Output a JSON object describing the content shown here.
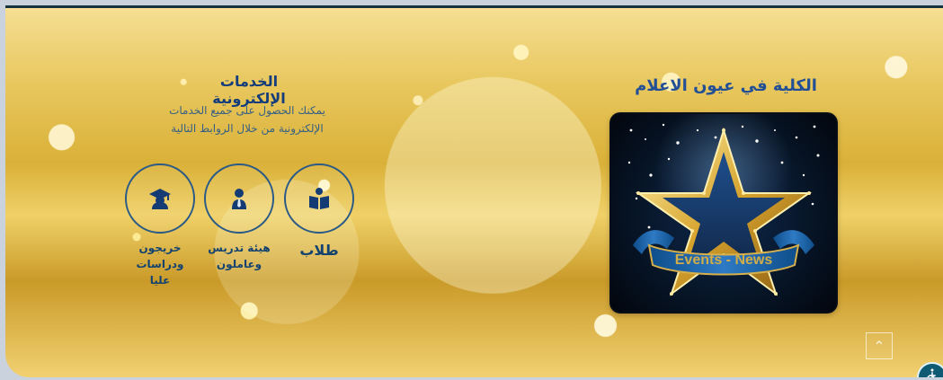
{
  "services": {
    "title": "الخدمات الإلكترونية",
    "description_line_1": "يمكنك الحصول على جميع الخدمات",
    "description_line_2": "الإلكترونية من خلال الروابط التالية",
    "items": [
      {
        "label": "خريجون",
        "label_line_2": "ودراسات",
        "label_line_3": "عليا",
        "icon": "graduate-icon"
      },
      {
        "label": "هيئة تدريس",
        "label_line_2": "وعاملون",
        "icon": "staff-icon"
      },
      {
        "label": "طلاب",
        "icon": "book-icon"
      }
    ]
  },
  "media": {
    "title": "الكلية في عيون الاعلام",
    "card_text": "Events - News"
  },
  "controls": {
    "scroll_top_icon": "chevron-up-icon",
    "accessibility_icon": "accessibility-icon"
  }
}
